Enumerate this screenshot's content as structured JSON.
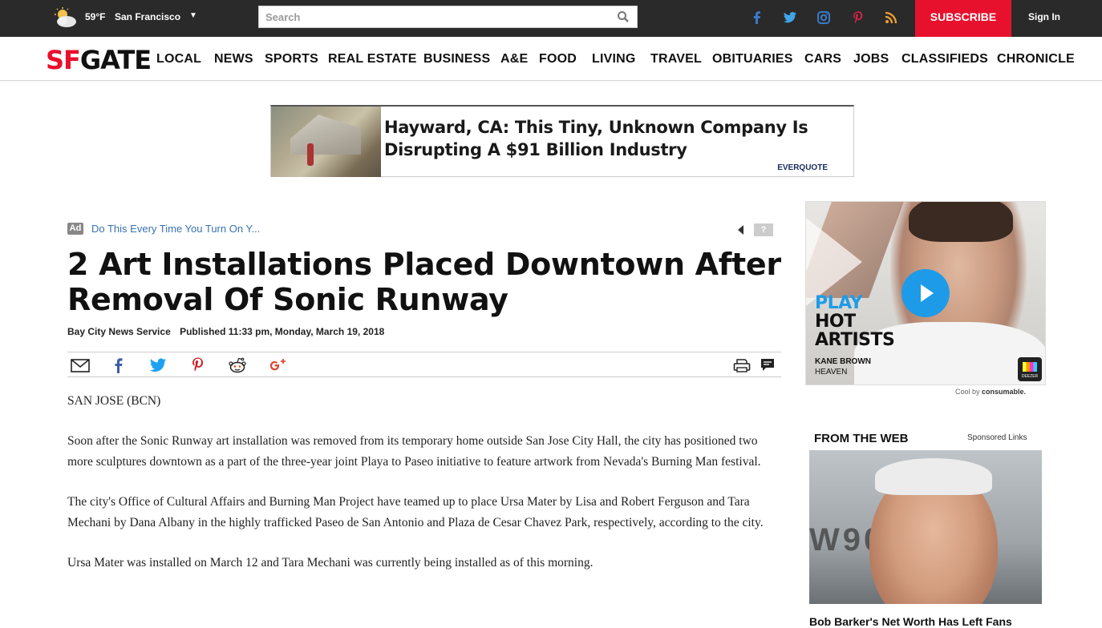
{
  "topbar": {
    "temperature": "59°F",
    "city": "San Francisco",
    "search_placeholder": "Search",
    "subscribe_label": "SUBSCRIBE",
    "signin_label": "Sign In"
  },
  "nav": {
    "logo_sf": "SF",
    "logo_gate": "GATE",
    "items": [
      "LOCAL",
      "NEWS",
      "SPORTS",
      "REAL ESTATE",
      "BUSINESS",
      "A&E",
      "FOOD",
      "LIVING",
      "TRAVEL",
      "OBITUARIES",
      "CARS",
      "JOBS",
      "CLASSIFIEDS",
      "CHRONICLE"
    ]
  },
  "banner_ad": {
    "headline": "Hayward, CA: This Tiny, Unknown Company Is Disrupting A $91 Billion Industry",
    "brand": "EVERQUOTE"
  },
  "article": {
    "ad_badge": "Ad",
    "ad_link": "Do This Every Time You Turn On Y...",
    "ad_help": "?",
    "title": "2 Art Installations Placed Downtown After Removal Of Sonic Runway",
    "source": "Bay City News Service",
    "published": "Published 11:33 pm, Monday, March 19, 2018",
    "paragraphs": [
      "SAN JOSE (BCN)",
      "Soon after the Sonic Runway art installation was removed from its temporary home outside San Jose City Hall, the city has positioned two more sculptures downtown as a part of the three-year joint Playa to Paseo initiative to feature artwork from Nevada's Burning Man festival.",
      "The city's Office of Cultural Affairs and Burning Man Project have teamed up to place Ursa Mater by Lisa and Robert Ferguson and Tara Mechani by Dana Albany in the highly trafficked Paseo de San Antonio and Plaza de Cesar Chavez Park, respectively, according to the city.",
      "Ursa Mater was installed on March 12 and Tara Mechani was currently being installed as of this morning."
    ]
  },
  "sidebar": {
    "video_ad": {
      "line1": "PLAY",
      "line2": "HOT",
      "line3": "ARTISTS",
      "artist": "KANE BROWN",
      "song": "HEAVEN",
      "app": "DEEZER"
    },
    "consumable_prefix": "Cool by",
    "consumable_brand": "consumable.",
    "from_the_web": "FROM THE WEB",
    "sponsored": "Sponsored Links",
    "ftw_caption": "Bob Barker's Net Worth Has Left Fans"
  },
  "colors": {
    "brand_red": "#e8112d",
    "topbar_bg": "#2a2a2a",
    "link_blue": "#3a72b0",
    "play_blue": "#1e9be8"
  }
}
